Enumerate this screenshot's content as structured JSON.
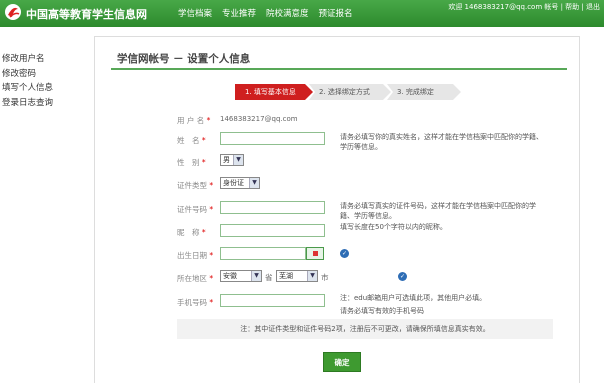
{
  "header": {
    "site_name": "中国高等教育学生信息网",
    "nav": [
      "学信档案",
      "专业推荐",
      "院校满意度",
      "预证报名"
    ],
    "user_info": "欢迎 1468383217@qq.com 帐号 | 帮助 | 退出"
  },
  "sidebar": {
    "items": [
      "修改用户名",
      "修改密码",
      "填写个人信息",
      "登录日志查询"
    ]
  },
  "main": {
    "title": "学信网帐号 － 设置个人信息",
    "steps": [
      "1. 填写基本信息",
      "2. 选择绑定方式",
      "3. 完成绑定"
    ]
  },
  "form": {
    "username_label": "用 户 名",
    "username_value": "1468383217@qq.com",
    "name_label": "姓　名",
    "gender_label": "性　别",
    "gender_value": "男",
    "id_type_label": "证件类型",
    "id_type_value": "身份证",
    "id_number_label": "证件号码",
    "nickname_label": "昵　称",
    "birthdate_label": "出生日期",
    "region_label": "所在地区",
    "province_value": "安徽",
    "province_suffix": "省",
    "city_value": "芜湖",
    "city_suffix": "市",
    "phone_label": "手机号码",
    "required_mark": "*"
  },
  "hints": {
    "name": "请务必填写你的真实姓名，这样才能在学信档案中匹配你的学籍、学历等信息。",
    "id_number": "请务必填写真实的证件号码，这样才能在学信档案中匹配你的学籍、学历等信息。",
    "nickname": "填写长度在50个字符以内的昵称。",
    "phone_1": "注：edu邮箱用户可选填此项，其他用户必填。",
    "phone_2": "请务必填写有效的手机号码"
  },
  "note": "注：其中证件类型和证件号码2项，注册后不可更改，请确保所填信息真实有效。",
  "confirm_label": "确定",
  "colors": {
    "header_green": "#2d8a2d",
    "active_step_red": "#cf1f1f",
    "button_green": "#3e9a30",
    "check_blue": "#2e6db5"
  }
}
